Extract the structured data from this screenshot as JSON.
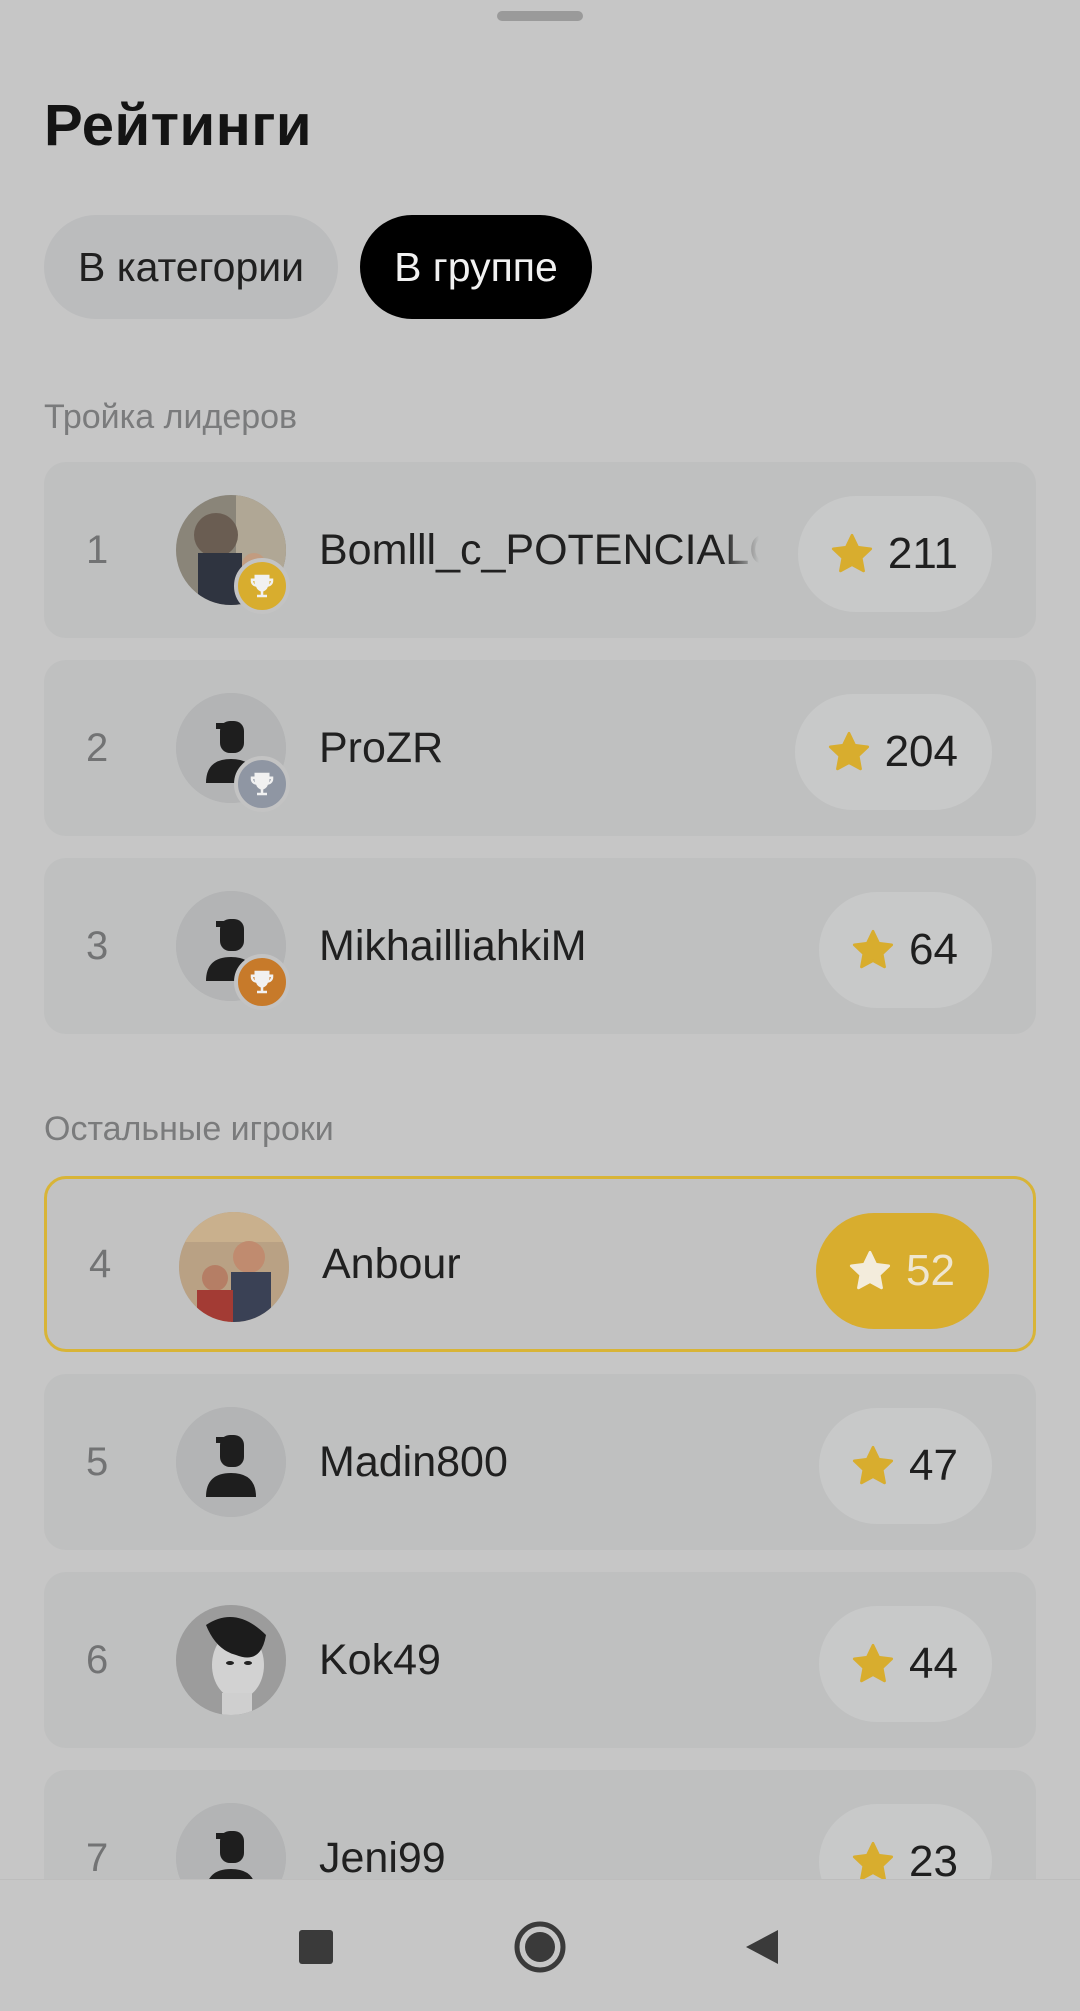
{
  "header": {
    "title": "Рейтинги"
  },
  "tabs": [
    {
      "label": "В категории",
      "active": false
    },
    {
      "label": "В группе",
      "active": true
    }
  ],
  "sections": {
    "leaders": "Тройка лидеров",
    "others": "Остальные игроки"
  },
  "players": [
    {
      "rank": "1",
      "name": "Bomlll_c_POTENCIALOM",
      "score": "211",
      "trophy": "gold",
      "avatar": "photo-man",
      "highlight": false
    },
    {
      "rank": "2",
      "name": "ProZR",
      "score": "204",
      "trophy": "silver",
      "avatar": "default",
      "highlight": false
    },
    {
      "rank": "3",
      "name": "MikhailliahkiM",
      "score": "64",
      "trophy": "bronze",
      "avatar": "default",
      "highlight": false
    },
    {
      "rank": "4",
      "name": "Anbour",
      "score": "52",
      "trophy": null,
      "avatar": "photo-poster",
      "highlight": true
    },
    {
      "rank": "5",
      "name": "Madin800",
      "score": "47",
      "trophy": null,
      "avatar": "default",
      "highlight": false
    },
    {
      "rank": "6",
      "name": "Kok49",
      "score": "44",
      "trophy": null,
      "avatar": "photo-portrait",
      "highlight": false
    },
    {
      "rank": "7",
      "name": "Jeni99",
      "score": "23",
      "trophy": null,
      "avatar": "default",
      "highlight": false
    }
  ],
  "colors": {
    "star": "#d8ad2e",
    "trophy_gold": "#d8ad2e",
    "trophy_silver": "#8f96a3",
    "trophy_bronze": "#c77a2a",
    "highlight_border": "#d8b437"
  },
  "navbar": {
    "icons": [
      "recent-apps-icon",
      "home-icon",
      "back-icon"
    ]
  }
}
